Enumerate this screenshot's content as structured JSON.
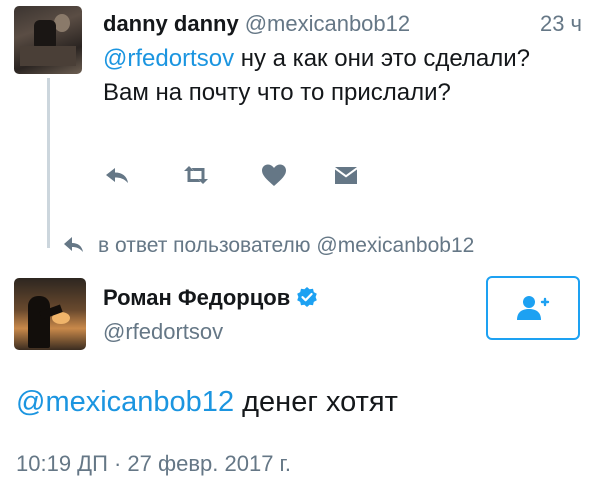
{
  "reply_tweet": {
    "author_name": "danny danny",
    "author_handle": "@mexicanbob12",
    "relative_time": "23 ч",
    "mention": "@rfedortsov",
    "text": " ну а как они это сделали? Вам на почту что то прислали?",
    "actions": [
      {
        "name": "reply",
        "icon": "reply-icon"
      },
      {
        "name": "retweet",
        "icon": "retweet-icon"
      },
      {
        "name": "like",
        "icon": "heart-icon"
      },
      {
        "name": "direct-message",
        "icon": "mail-icon"
      }
    ]
  },
  "reply_context": {
    "prefix": "в ответ пользователю ",
    "handle": "@mexicanbob12"
  },
  "main_tweet": {
    "author_name": "Роман Федорцов",
    "verified": true,
    "author_handle": "@rfedortsov",
    "mention": "@mexicanbob12",
    "text": " денег хотят",
    "timestamp": "10:19 ДП · 27 февр. 2017 г."
  },
  "colors": {
    "link": "#1b95e0",
    "secondary_text": "#657786",
    "icon": "#657786",
    "follow_border": "#1da1f2",
    "verified": "#1da1f2"
  }
}
